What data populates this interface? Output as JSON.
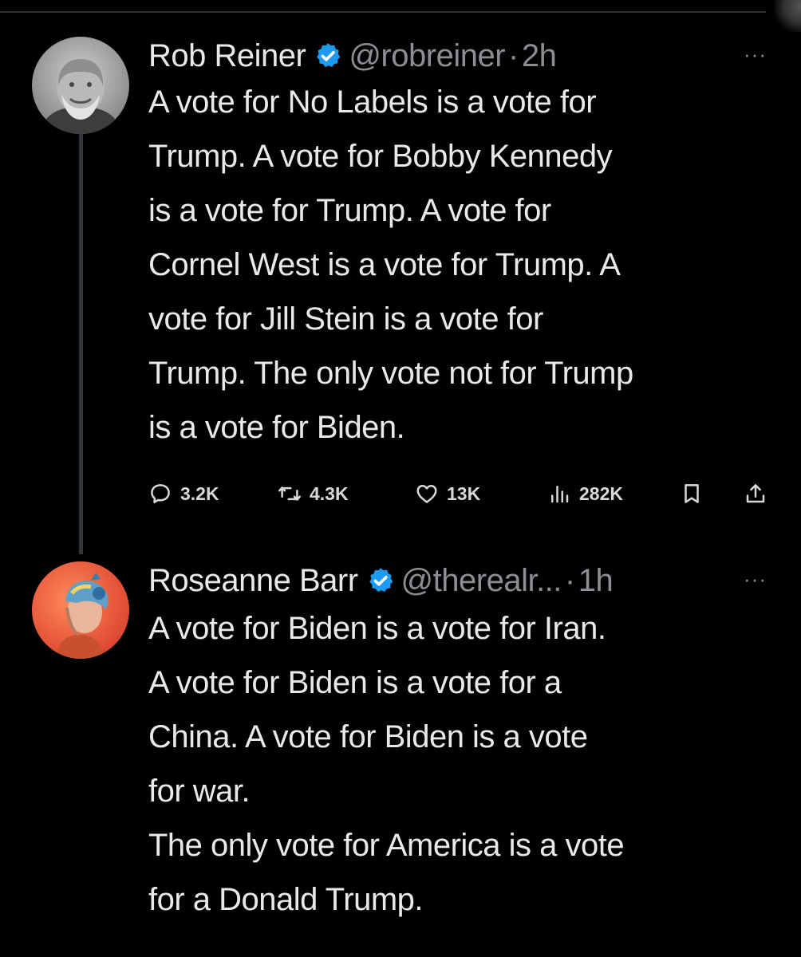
{
  "tweets": [
    {
      "display_name": "Rob Reiner",
      "handle": "@robreiner",
      "separator": "·",
      "time": "2h",
      "more": "···",
      "lines": [
        "A vote for No Labels is a vote for",
        "Trump. A vote for Bobby Kennedy",
        "is a vote for Trump. A vote for",
        "Cornel West is a vote for Trump. A",
        "vote for Jill Stein is a vote for",
        "Trump. The only vote not for Trump",
        "is a vote for Biden."
      ],
      "metrics": {
        "replies": "3.2K",
        "reposts": "4.3K",
        "likes": "13K",
        "views": "282K"
      }
    },
    {
      "display_name": "Roseanne Barr",
      "handle": "@therealr...",
      "separator": "·",
      "time": "1h",
      "more": "···",
      "lines": [
        "A vote for Biden is a vote for Iran.",
        "A vote for Biden is a vote for a",
        "China. A vote for Biden is a vote",
        "for war.",
        "The only vote for America is a vote",
        "for a Donald Trump."
      ]
    }
  ],
  "colors": {
    "background": "#000000",
    "text": "#e7e9ea",
    "secondary": "#8b8f94",
    "verified_blue": "#1d9bf0"
  },
  "icons": [
    "reply-icon",
    "repost-icon",
    "like-icon",
    "views-icon",
    "bookmark-icon",
    "share-icon",
    "verified-badge-icon",
    "more-icon"
  ]
}
